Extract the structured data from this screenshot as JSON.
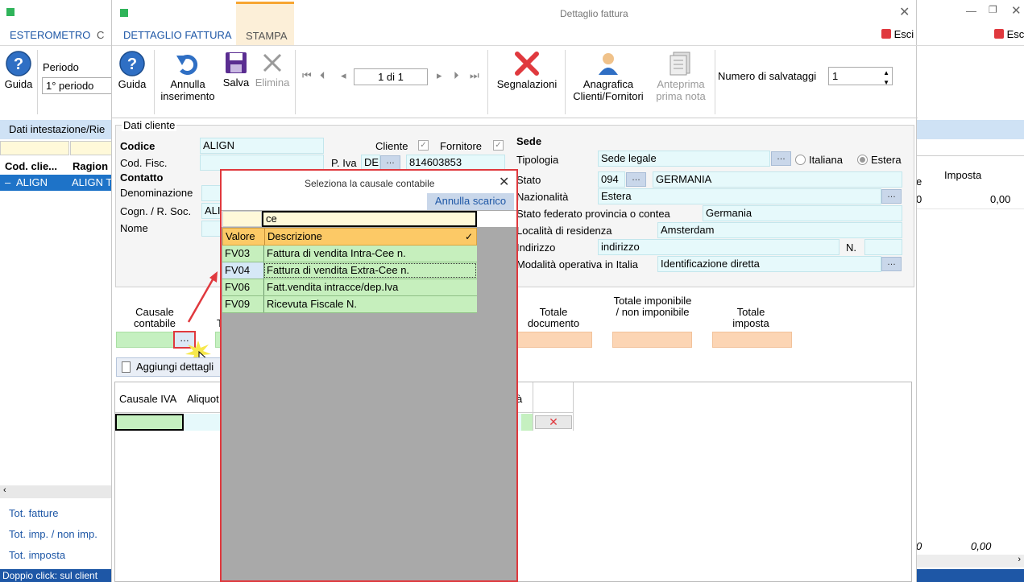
{
  "bg_window": {
    "tabs": [
      {
        "label": "ESTEROMETRO"
      },
      {
        "label": "C"
      }
    ],
    "toolbar": {
      "guida_label": "Guida",
      "periodo_label": "Periodo",
      "periodo_value": "1° periodo"
    },
    "section_title": "Dati intestazione/Rie",
    "grid_headers": [
      "Cod. clie...",
      "Ragion"
    ],
    "grid_row": [
      "ALIGN",
      "ALIGN T"
    ],
    "totals": [
      "Tot. fatture",
      "Tot. imp. / non imp.",
      "Tot. imposta"
    ],
    "status": "Doppio click: sul client"
  },
  "right_window": {
    "exit_label": "Esci",
    "col_e": "e",
    "imposta_header": "Imposta",
    "row_val_left": "0",
    "row_val": "0,00",
    "bottom_left": "0",
    "bottom_val": "0,00"
  },
  "detail_window": {
    "title": "Dettaglio fattura",
    "tabs": [
      {
        "label": "DETTAGLIO FATTURA"
      },
      {
        "label": "STAMPA"
      }
    ],
    "exit_label": "Esci",
    "toolbar": {
      "guida": "Guida",
      "annulla": "Annulla inserimento",
      "salva": "Salva",
      "elimina": "Elimina",
      "nav_value": "1 di 1",
      "segnalazioni": "Segnalazioni",
      "anagrafica": "Anagrafica Clienti/Fornitori",
      "anteprima": "Anteprima prima nota",
      "salvataggi_label": "Numero di salvataggi",
      "salvataggi_value": "1"
    },
    "cliente": {
      "section_title": "Dati cliente",
      "codice_label": "Codice",
      "codice_value": "ALIGN",
      "cod_fisc_label": "Cod. Fisc.",
      "contatto_label": "Contatto",
      "denominazione_label": "Denominazione",
      "cognome_label": "Cogn. / R. Soc.",
      "cognome_value": "ALI",
      "nome_label": "Nome",
      "cliente_label": "Cliente",
      "fornitore_label": "Fornitore",
      "piva_label": "P. Iva",
      "piva_country": "DE",
      "piva_value": "814603853"
    },
    "sede": {
      "title": "Sede",
      "tipologia_label": "Tipologia",
      "tipologia_value": "Sede legale",
      "italiana_label": "Italiana",
      "estera_label": "Estera",
      "stato_label": "Stato",
      "stato_code": "094",
      "stato_name": "GERMANIA",
      "nazionalita_label": "Nazionalità",
      "nazionalita_value": "Estera",
      "federato_label": "Stato federato provincia o contea",
      "federato_value": "Germania",
      "localita_label": "Località di residenza",
      "localita_value": "Amsterdam",
      "indirizzo_label": "Indirizzo",
      "indirizzo_value": "indirizzo",
      "numero_label": "N.",
      "modalita_label": "Modalità operativa in Italia",
      "modalita_value": "Identificazione diretta"
    },
    "causale_label": "Causale contabile",
    "t_partial": "T",
    "totale_documento": "Totale documento",
    "totale_imponibile": "Totale imponibile / non imponibile",
    "totale_imposta": "Totale imposta",
    "aggiungi_label": "Aggiungi dettagli",
    "grid_headers": [
      "Causale IVA",
      "Aliquot",
      "à"
    ]
  },
  "dialog": {
    "title": "Seleziona la causale contabile",
    "annulla_label": "Annulla scarico",
    "search_value": "ce",
    "col_valore": "Valore",
    "col_descrizione": "Descrizione",
    "rows": [
      {
        "code": "FV03",
        "desc": "Fattura di vendita Intra-Cee n."
      },
      {
        "code": "FV04",
        "desc": "Fattura di vendita Extra-Cee n."
      },
      {
        "code": "FV06",
        "desc": "Fatt.vendita intracce/dep.Iva"
      },
      {
        "code": "FV09",
        "desc": "Ricevuta Fiscale N."
      }
    ]
  },
  "colors": {
    "dialog_border": "#e0393e",
    "row_green": "#c6efbd",
    "row_selected": "#d6e8f7",
    "header_orange": "#fcc966",
    "field_cyan": "#e6f9fb",
    "total_orange": "#fcd5b4",
    "accent_blue": "#1e57a6"
  }
}
